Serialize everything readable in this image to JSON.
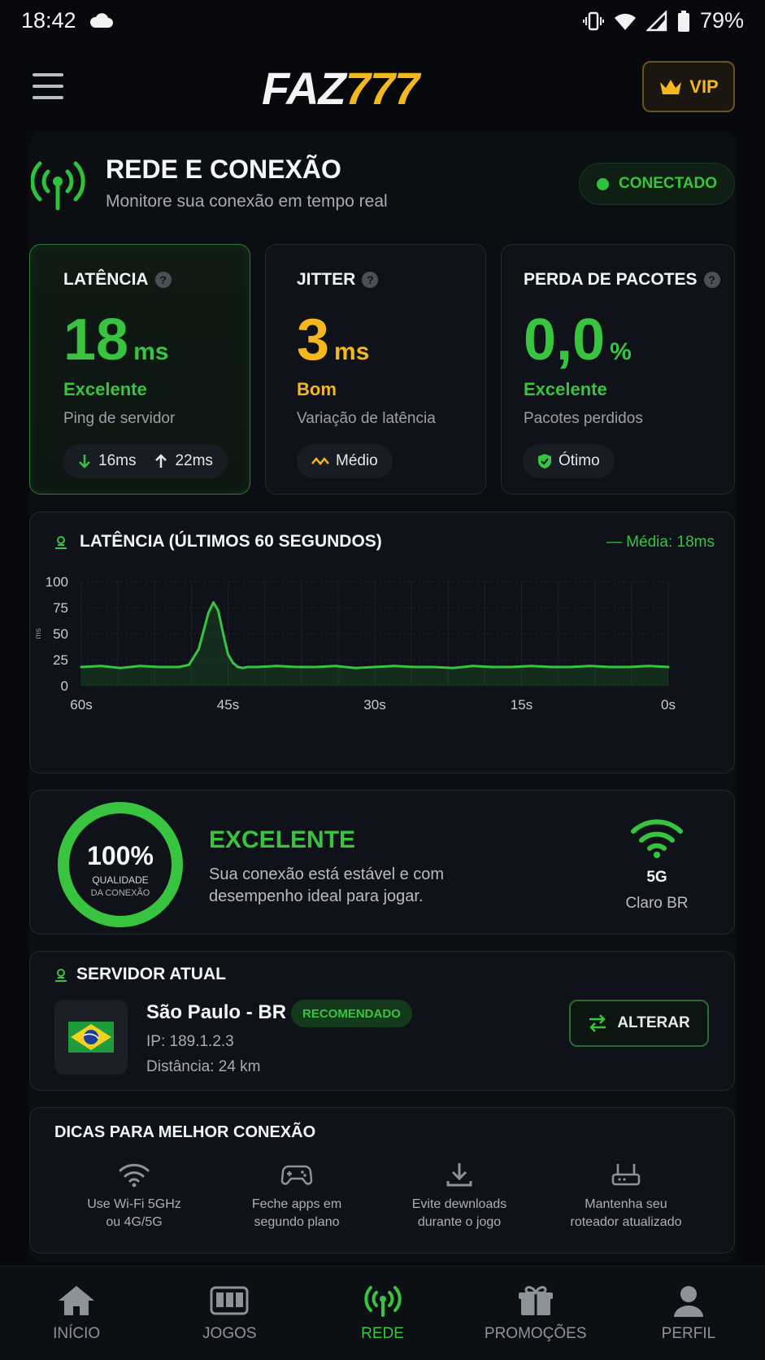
{
  "status_bar": {
    "time": "18:42",
    "battery": "79%"
  },
  "header": {
    "logo_left": "FAZ",
    "logo_right": "777",
    "vip_label": "VIP"
  },
  "page": {
    "title": "REDE E CONEXÃO",
    "subtitle": "Monitore sua conexão em tempo real",
    "connection_status": "CONECTADO"
  },
  "metrics": [
    {
      "title": "LATÊNCIA",
      "value": "18",
      "unit": "ms",
      "grade": "Excelente",
      "desc": "Ping de servidor",
      "chip_down": "16ms",
      "chip_up": "22ms"
    },
    {
      "title": "JITTER",
      "value": "3",
      "unit": "ms",
      "grade": "Bom",
      "desc": "Variação de latência",
      "chip": "Médio"
    },
    {
      "title": "PERDA DE PACOTES",
      "value": "0,0",
      "unit": "%",
      "grade": "Excelente",
      "desc": "Pacotes perdidos",
      "chip": "Ótimo"
    }
  ],
  "chart_data": {
    "type": "line",
    "title": "LATÊNCIA (ÚLTIMOS 60 SEGUNDOS)",
    "average_label": "Média: 18ms",
    "ylabel": "ms",
    "ylim": [
      0,
      100
    ],
    "yticks": [
      "100",
      "75",
      "50",
      "25",
      "0"
    ],
    "xticks": [
      "60s",
      "45s",
      "30s",
      "15s",
      "0s"
    ],
    "x": [
      60,
      58,
      56,
      54,
      52,
      50,
      49,
      48,
      47,
      46.5,
      46,
      45.5,
      45,
      44.5,
      44,
      43.5,
      43,
      42,
      40,
      38,
      36,
      34,
      32,
      30,
      28,
      26,
      24,
      22,
      20,
      18,
      16,
      14,
      12,
      10,
      8,
      6,
      4,
      2,
      0
    ],
    "values": [
      18,
      19,
      17,
      19,
      18,
      18,
      20,
      35,
      70,
      80,
      72,
      50,
      30,
      22,
      18,
      17,
      18,
      18,
      19,
      18,
      18,
      19,
      17,
      18,
      19,
      18,
      18,
      17,
      19,
      18,
      18,
      19,
      18,
      18,
      19,
      18,
      18,
      19,
      18
    ],
    "grid": true
  },
  "quality": {
    "percent": 100,
    "percent_label": "100%",
    "caption_1": "QUALIDADE",
    "caption_2": "DA CONEXÃO",
    "grade": "EXCELENTE",
    "text": "Sua conexão está estável e com desempenho ideal para jogar.",
    "network": "5G",
    "carrier": "Claro BR"
  },
  "server": {
    "section_title": "SERVIDOR ATUAL",
    "city": "São Paulo - BR",
    "badge": "RECOMENDADO",
    "ip": "IP: 189.1.2.3",
    "distance": "Distância: 24 km",
    "change_label": "ALTERAR"
  },
  "tips": {
    "title": "DICAS PARA MELHOR CONEXÃO",
    "items": [
      {
        "icon": "wifi-icon",
        "line1": "Use Wi-Fi 5GHz",
        "line2": "ou 4G/5G"
      },
      {
        "icon": "gamepad-icon",
        "line1": "Feche apps em",
        "line2": "segundo plano"
      },
      {
        "icon": "download-icon",
        "line1": "Evite dewnloads",
        "line2": "durante o jogo"
      },
      {
        "icon": "router-icon",
        "line1": "Mantenha seu",
        "line2": "roteador atualizado"
      }
    ]
  },
  "nav": [
    {
      "label": "INÍCIO",
      "icon": "home-icon"
    },
    {
      "label": "JOGOS",
      "icon": "slot-icon"
    },
    {
      "label": "REDE",
      "icon": "antenna-icon",
      "active": true
    },
    {
      "label": "PROMOÇÕES",
      "icon": "gift-icon"
    },
    {
      "label": "PERFIL",
      "icon": "user-icon"
    }
  ],
  "colors": {
    "accent_green": "#38c43f",
    "accent_yellow": "#f3b71f",
    "background": "#07090c"
  }
}
